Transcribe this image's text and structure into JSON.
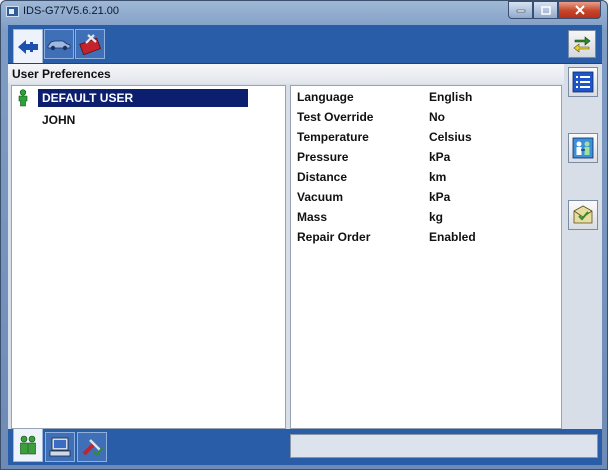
{
  "window": {
    "title": "IDS-G77V5.6.21.00"
  },
  "section": {
    "title": "User Preferences"
  },
  "users": [
    {
      "name": "DEFAULT USER",
      "selected": true
    },
    {
      "name": "JOHN",
      "selected": false
    }
  ],
  "preferences": [
    {
      "name": "Language",
      "value": "English"
    },
    {
      "name": "Test Override",
      "value": "No"
    },
    {
      "name": "Temperature",
      "value": "Celsius"
    },
    {
      "name": "Pressure",
      "value": "kPa"
    },
    {
      "name": "Distance",
      "value": "km"
    },
    {
      "name": "Vacuum",
      "value": "kPa"
    },
    {
      "name": "Mass",
      "value": "kg"
    },
    {
      "name": "Repair Order",
      "value": "Enabled"
    }
  ],
  "icons": {
    "tab1": "connector-arrow-icon",
    "tab2": "vehicle-icon",
    "tab3": "toolbox-icon",
    "topright": "swap-arrows-icon",
    "side1": "list-icon",
    "side2": "user-transfer-icon",
    "side3": "envelope-check-icon",
    "bottom1": "users-icon",
    "bottom2": "computer-settings-icon",
    "bottom3": "tools-check-icon"
  },
  "colors": {
    "toolbar": "#2a5da7",
    "selection": "#0c1e6e"
  }
}
